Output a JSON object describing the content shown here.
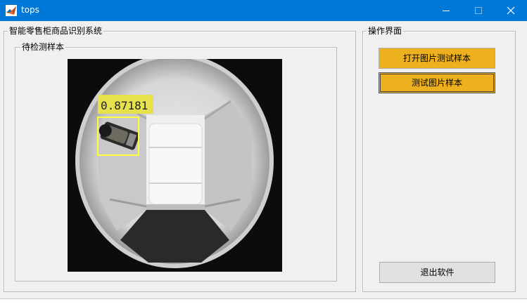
{
  "window": {
    "title": "tops",
    "app_icon": "matlab-icon",
    "controls": [
      "minimize-icon",
      "maximize-icon",
      "close-icon"
    ],
    "accent_color": "#0078d7"
  },
  "main_panel": {
    "title": "智能零售柜商品识别系统",
    "sample_panel": {
      "title": "待检测样本",
      "detection": {
        "score": "0.87181",
        "box_color": "#ffff3c"
      }
    }
  },
  "operations_panel": {
    "title": "操作界面",
    "open_button_label": "打开图片测试样本",
    "test_button_label": "测试图片样本",
    "exit_button_label": "退出软件",
    "button_color": "#edb120"
  }
}
